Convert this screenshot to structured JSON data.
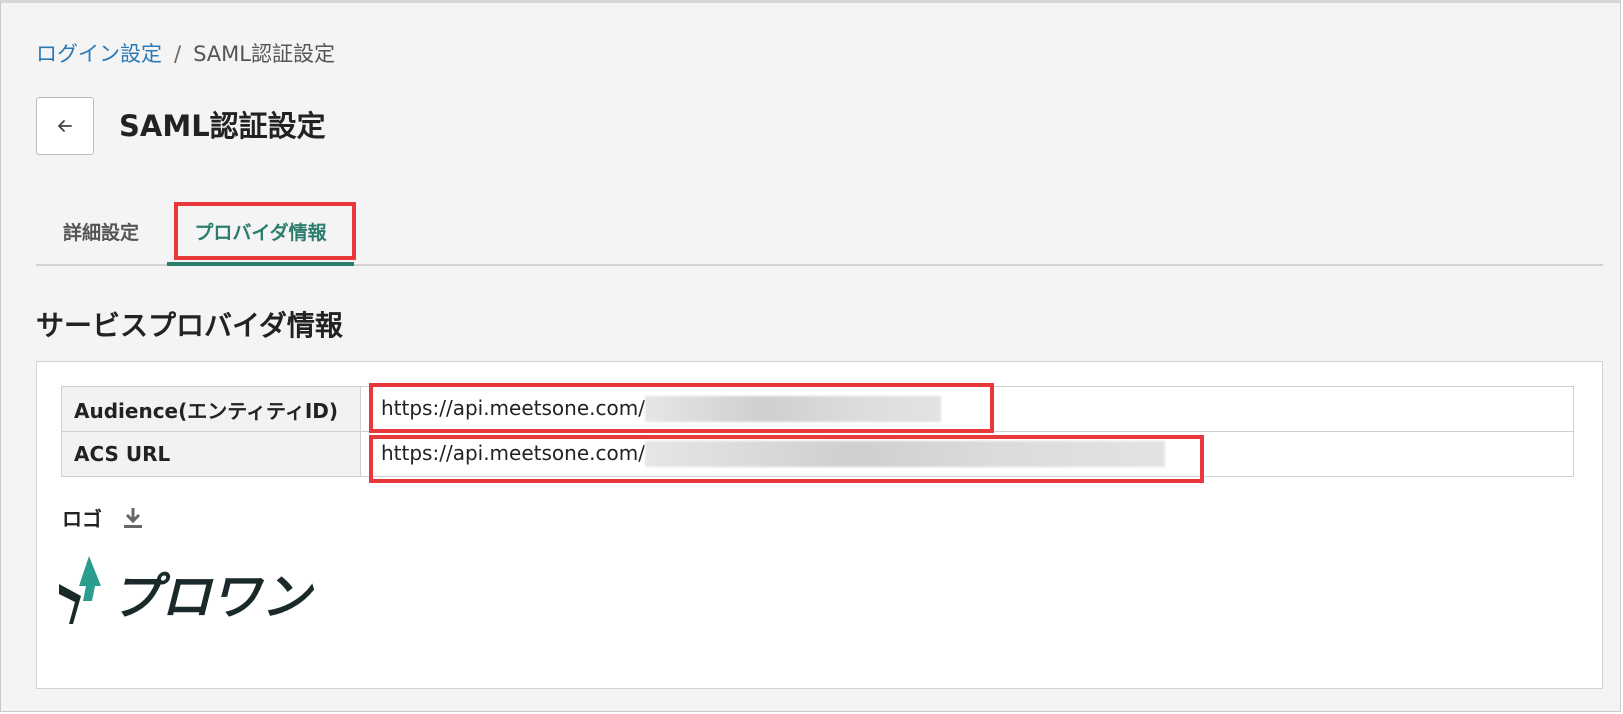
{
  "breadcrumb": {
    "parent": "ログイン設定",
    "separator": "/",
    "current": "SAML認証設定"
  },
  "page": {
    "title": "SAML認証設定",
    "back_icon": "arrow-left-icon"
  },
  "tabs": [
    {
      "label": "詳細設定",
      "active": false
    },
    {
      "label": "プロバイダ情報",
      "active": true
    }
  ],
  "section": {
    "title": "サービスプロバイダ情報"
  },
  "table": {
    "rows": [
      {
        "label": "Audience(エンティティID)",
        "value": "https://api.meetsone.com/"
      },
      {
        "label": "ACS URL",
        "value": "https://api.meetsone.com/"
      }
    ]
  },
  "logo": {
    "label": "ロゴ",
    "download_icon": "download-icon",
    "brand_text": "プロワン"
  },
  "colors": {
    "accent": "#2d7d6f",
    "link": "#2a7ab8",
    "highlight": "#e8383c",
    "logo_teal": "#2a9d8f",
    "logo_dark": "#1a2a2a"
  }
}
